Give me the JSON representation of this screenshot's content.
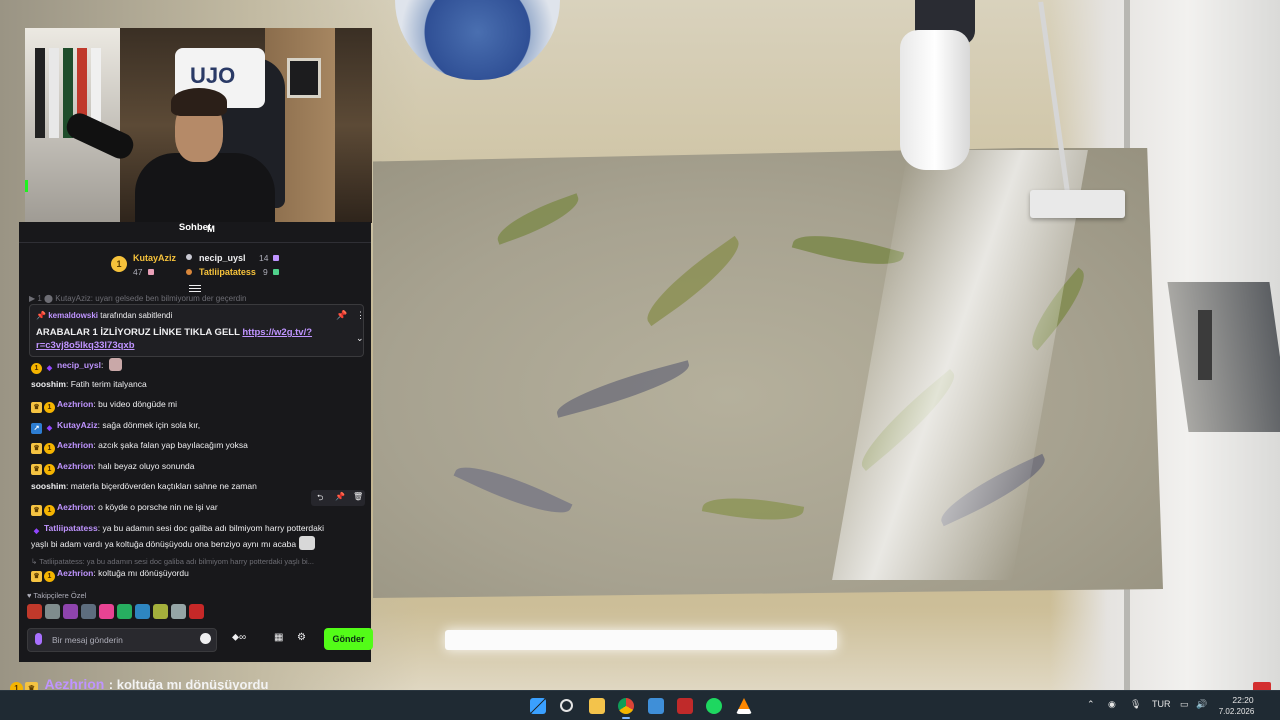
{
  "colors": {
    "accent": "#bf94ff",
    "send_button": "#53fc18",
    "panel_bg": "#18181b",
    "taskbar_bg": "#1f2a33"
  },
  "chat": {
    "title": "Sohbet",
    "title_suffix": "M",
    "leaderboard": [
      {
        "rank": "1",
        "name": "KutayAziz",
        "count": "47",
        "name_color": "#f6c23b"
      },
      {
        "rank": "",
        "name": "necip_uysl",
        "count": "14",
        "name_color": "#efeff1"
      },
      {
        "rank": "",
        "name": "Tatliipatatess",
        "count": "9",
        "name_color": "#f6c23b"
      }
    ],
    "previous_line": "▶ 1 ⬤ KutayAziz: uyarı gelsede ben bilmiyorum der geçerdin",
    "pinned": {
      "pinned_by": "kemaldowski",
      "pinned_by_suffix": "tarafından sabitlendi",
      "text": "ARABALAR 1 İZLİYORUZ LİNKE TIKLA GELL",
      "link": "https://w2g.tv/?r=c3vj8o5lkq33l73qxb"
    },
    "messages": [
      {
        "badges": [
          "one",
          "prime"
        ],
        "user": "necip_uysl",
        "text": "",
        "color": "#bf94ff"
      },
      {
        "badges": [],
        "user": "sooshim",
        "text": "Fatih terim italyanca",
        "color": "#efeff1"
      },
      {
        "badges": [
          "crown",
          "one"
        ],
        "user": "Aezhrion",
        "text": "bu video döngüde mi",
        "color": "#bf94ff"
      },
      {
        "badges": [
          "turbo",
          "prime"
        ],
        "user": "KutayAziz",
        "text": "sağa dönmek için sola kır,",
        "color": "#bf94ff"
      },
      {
        "badges": [
          "crown",
          "one"
        ],
        "user": "Aezhrion",
        "text": "azcık şaka falan yap bayılacağım yoksa",
        "color": "#bf94ff"
      },
      {
        "badges": [
          "crown",
          "one"
        ],
        "user": "Aezhrion",
        "text": "halı beyaz oluyo sonunda",
        "color": "#bf94ff"
      },
      {
        "badges": [],
        "user": "sooshim",
        "text": "materla biçerdöverden kaçtıkları sahne ne zaman",
        "color": "#efeff1"
      },
      {
        "badges": [
          "crown",
          "one"
        ],
        "user": "Aezhrion",
        "text": "o köyde o porsche nin ne işi var",
        "color": "#bf94ff"
      },
      {
        "badges": [
          "prime"
        ],
        "user": "Tatliipatatess",
        "text": "ya bu adamın sesi doc galiba adı bilmiyom harry potterdaki",
        "color": "#bf94ff"
      },
      {
        "badges": [],
        "user": "",
        "text": "yaşlı bi adam vardı ya koltuğa dönüşüyodu ona benziyo aynı mı acaba",
        "color": "#efeff1"
      },
      {
        "badges": [
          "crown",
          "one"
        ],
        "user": "Aezhrion",
        "text": "koltuğa mı dönüşüyordu",
        "color": "#bf94ff"
      }
    ],
    "reply_preview": "↳ Tatliipatatess: ya bu adamın sesi doc galiba adı bilmiyom harry potterdaki yaşlı bi...",
    "followers_label": "Takipçilere Özel",
    "input_placeholder": "Bir mesaj gönderin",
    "send_label": "Gönder",
    "hover_actions": [
      "reply-icon",
      "pin-icon",
      "delete-icon"
    ]
  },
  "overlay": {
    "user": "Aezhrion",
    "text": ": koltuğa mı dönüşüyordu"
  },
  "taskbar": {
    "language": "TUR",
    "time": "22:20",
    "date": "7.02.2026",
    "apps": [
      "windows-start",
      "search",
      "file-explorer",
      "chrome",
      "photos",
      "app-red",
      "spotify",
      "vlc"
    ]
  },
  "webcam": {
    "jersey_text": "UJO"
  }
}
